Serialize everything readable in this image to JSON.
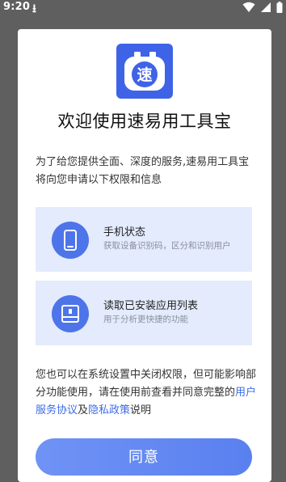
{
  "status_bar": {
    "time": "9:20",
    "download_glyph": "⭳",
    "icons": [
      "download-icon",
      "wifi-icon",
      "signal-icon",
      "battery-icon"
    ]
  },
  "dialog": {
    "logo_char": "速",
    "title": "欢迎使用速易用工具宝",
    "intro": "为了给您提供全面、深度的服务,速易用工具宝将向您申请以下权限和信息",
    "permissions": [
      {
        "title": "手机状态",
        "description": "获取设备识别码，区分和识别用户",
        "icon": "phone-icon"
      },
      {
        "title": "读取已安装应用列表",
        "description": "用于分析更快捷的功能",
        "icon": "app-list-icon"
      }
    ],
    "footer": {
      "prefix": "您也可以在系统设置中关闭权限，但可能影响部分功能使用，请在使用前查看并同意完整的",
      "user_agreement_link": "用户服务协议",
      "conjunction": "及",
      "privacy_policy_link": "隐私政策",
      "suffix": "说明"
    },
    "agree_button": "同意"
  },
  "colors": {
    "accent": "#3f63e6",
    "card_background": "#e3ebfd",
    "link": "#3d6ce8",
    "overlay": "#5f5f5f"
  }
}
